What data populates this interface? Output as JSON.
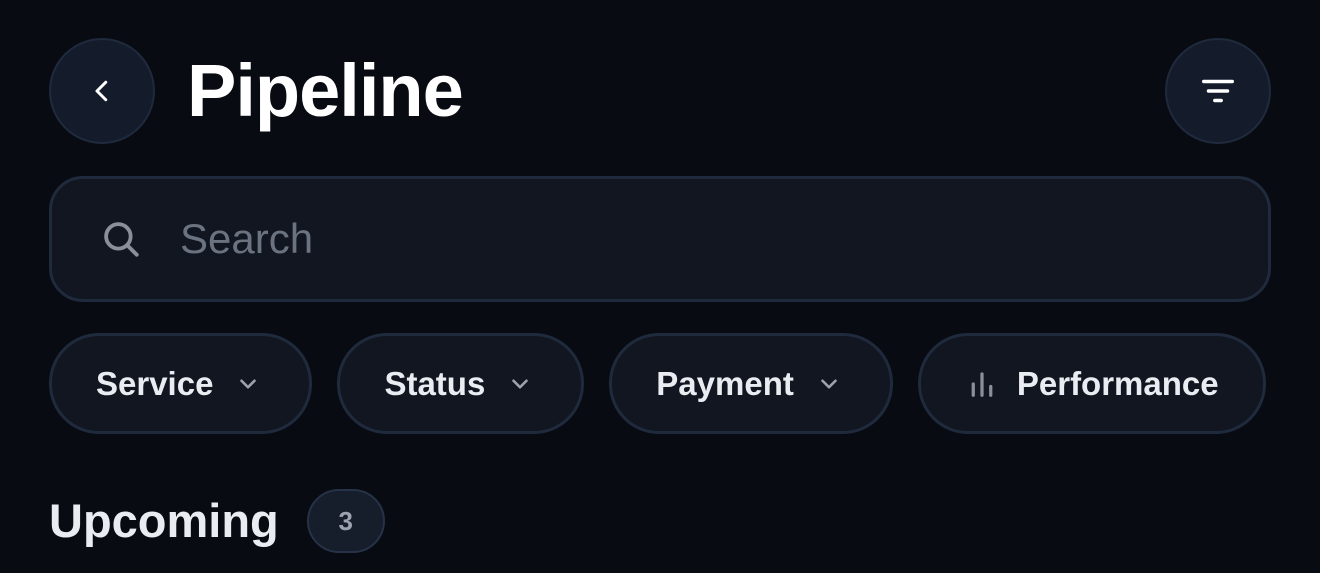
{
  "header": {
    "title": "Pipeline",
    "back_icon": "chevron-left-icon",
    "filter_icon": "filter-lines-icon"
  },
  "search": {
    "placeholder": "Search",
    "value": "",
    "icon": "search-icon"
  },
  "filters": [
    {
      "label": "Service",
      "icon": "chevron-down-icon"
    },
    {
      "label": "Status",
      "icon": "chevron-down-icon"
    },
    {
      "label": "Payment",
      "icon": "chevron-down-icon"
    },
    {
      "label": "Performance",
      "icon": "bar-chart-icon"
    }
  ],
  "section": {
    "heading": "Upcoming",
    "count": "3"
  },
  "colors": {
    "background": "#090b12",
    "surface": "#111621",
    "border": "#1f2a3d",
    "button": "#141c2c"
  }
}
